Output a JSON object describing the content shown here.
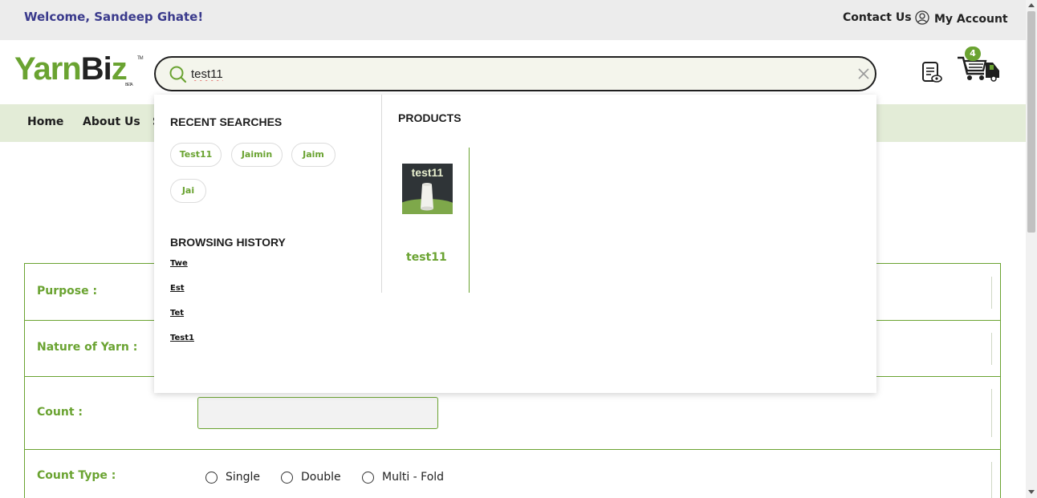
{
  "topbar": {
    "welcome": "Welcome, Sandeep Ghate!",
    "contact": "Contact Us",
    "account": "My Account"
  },
  "logo": {
    "part1": "Yarn",
    "part2": "Bi",
    "part3": "z",
    "tm": "TM",
    "beta": "BETA"
  },
  "search": {
    "value": "test11",
    "placeholder": ""
  },
  "cart": {
    "count": "4"
  },
  "nav": {
    "items": [
      "Home",
      "About Us",
      "S"
    ]
  },
  "dropdown": {
    "recent_heading": "RECENT SEARCHES",
    "recent": [
      "Test11",
      "Jaimin",
      "Jaim",
      "Jai"
    ],
    "history_heading": "BROWSING HISTORY",
    "history": [
      "Twe",
      "Est",
      "Tet",
      "Test1"
    ],
    "products_heading": "PRODUCTS",
    "products": [
      {
        "thumb_label": "test11",
        "name": "test11"
      }
    ]
  },
  "form": {
    "purpose_label": "Purpose :",
    "nature_label": "Nature of Yarn :",
    "count_label": "Count :",
    "count_value": "",
    "count_type_label": "Count Type :",
    "count_type_options": [
      "Single",
      "Double",
      "Multi - Fold"
    ]
  },
  "colors": {
    "brand_green": "#6aa331",
    "nav_bg": "#e3ecd7",
    "welcome_text": "#3a3a8c"
  }
}
